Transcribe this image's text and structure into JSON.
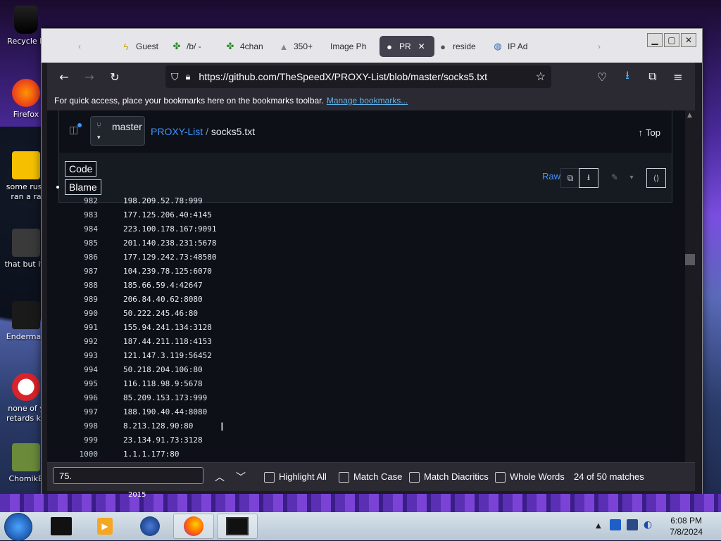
{
  "desktop": {
    "icons": [
      {
        "label": "Recycle B",
        "id": "recycle-bin"
      },
      {
        "label": "Firefox",
        "id": "firefox"
      },
      {
        "label": "some russ ran a ra",
        "id": "ransomware-note"
      },
      {
        "label": "that but its",
        "id": "folder"
      },
      {
        "label": "Enderman",
        "id": "enderman"
      },
      {
        "label": "none of y retards kn",
        "id": "note"
      },
      {
        "label": "ChomikB",
        "id": "chomik"
      }
    ],
    "year_label": "2015"
  },
  "browser": {
    "tabs": [
      {
        "label": "Guest"
      },
      {
        "label": "/b/ -"
      },
      {
        "label": "4chan"
      },
      {
        "label": "350+"
      },
      {
        "label": "Image Ph"
      },
      {
        "label": "PR"
      },
      {
        "label": "reside"
      },
      {
        "label": "IP Ad"
      }
    ],
    "url": "https://github.com/TheSpeedX/PROXY-List/blob/master/socks5.txt",
    "bookmarks_text": "For quick access, place your bookmarks here on the bookmarks toolbar.",
    "bookmarks_link": "Manage bookmarks..."
  },
  "github": {
    "branch": "master",
    "repo": "PROXY-List",
    "separator": "/",
    "file": "socks5.txt",
    "top_label": "Top",
    "code_tab": "Code",
    "blame_tab": "Blame",
    "raw_label": "Raw",
    "lines": [
      {
        "n": "982",
        "t": "198.209.52.78:999"
      },
      {
        "n": "983",
        "t": "177.125.206.40:4145"
      },
      {
        "n": "984",
        "t": "223.100.178.167:9091"
      },
      {
        "n": "985",
        "t": "201.140.238.231:5678"
      },
      {
        "n": "986",
        "t": "177.129.242.73:48580"
      },
      {
        "n": "987",
        "t": "104.239.78.125:6070"
      },
      {
        "n": "988",
        "t": "185.66.59.4:42647"
      },
      {
        "n": "989",
        "t": "206.84.40.62:8080"
      },
      {
        "n": "990",
        "t": "50.222.245.46:80"
      },
      {
        "n": "991",
        "t": "155.94.241.134:3128"
      },
      {
        "n": "992",
        "t": "187.44.211.118:4153"
      },
      {
        "n": "993",
        "t": "121.147.3.119:56452"
      },
      {
        "n": "994",
        "t": "50.218.204.106:80"
      },
      {
        "n": "995",
        "t": "116.118.98.9:5678"
      },
      {
        "n": "996",
        "t": "85.209.153.173:999"
      },
      {
        "n": "997",
        "t": "188.190.40.44:8080"
      },
      {
        "n": "998",
        "t": "8.213.128.90:80"
      },
      {
        "n": "999",
        "t": "23.134.91.73:3128"
      },
      {
        "n": "1000",
        "t": "1.1.1.177:80"
      }
    ]
  },
  "findbar": {
    "value": "75.",
    "highlight_all": "Highlight All",
    "match_case": "Match Case",
    "match_diacritics": "Match Diacritics",
    "whole_words": "Whole Words",
    "status": "24 of 50 matches"
  },
  "taskbar": {
    "time": "6:08 PM",
    "date": "7/8/2024"
  },
  "colors": {
    "accent": "#4493f8",
    "browser_chrome": "#2b2a33",
    "page_bg": "#0d1117"
  }
}
